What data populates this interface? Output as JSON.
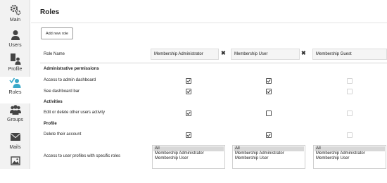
{
  "sidebar": {
    "items": [
      {
        "label": "Main",
        "icon": "gears-icon",
        "active": false
      },
      {
        "label": "Users",
        "icon": "user-icon",
        "active": false
      },
      {
        "label": "Profile",
        "icon": "profile-icon",
        "active": false
      },
      {
        "label": "Roles",
        "icon": "roles-icon",
        "active": true
      },
      {
        "label": "Groups",
        "icon": "groups-icon",
        "active": false
      },
      {
        "label": "Mails",
        "icon": "mail-icon",
        "active": false
      },
      {
        "label": "",
        "icon": "image-icon",
        "active": false
      }
    ]
  },
  "page": {
    "title": "Roles",
    "add_button_label": "Add new role"
  },
  "roles_table": {
    "name_header": "Role Name",
    "roles": [
      {
        "name": "Membership Administrator",
        "deletable": true
      },
      {
        "name": "Membership User",
        "deletable": true
      },
      {
        "name": "Membership Guest",
        "deletable": false
      }
    ],
    "delete_symbol": "✖",
    "sections": [
      {
        "title": "Administrative permissions",
        "rows": [
          {
            "label": "Access to admin dashboard",
            "values": [
              true,
              true,
              false
            ],
            "disabled": [
              false,
              false,
              true
            ]
          },
          {
            "label": "See dashboard bar",
            "values": [
              true,
              true,
              false
            ],
            "disabled": [
              false,
              false,
              true
            ]
          }
        ]
      },
      {
        "title": "Activities",
        "rows": [
          {
            "label": "Edit or delete other users activity",
            "values": [
              true,
              false,
              false
            ],
            "disabled": [
              false,
              false,
              true
            ]
          }
        ]
      },
      {
        "title": "Profile",
        "rows": [
          {
            "label": "Delete their account",
            "values": [
              true,
              true,
              false
            ],
            "disabled": [
              false,
              false,
              true
            ]
          }
        ]
      }
    ],
    "profiles_access": {
      "label": "Access to user profiles with specific roles",
      "options": [
        "All",
        "Membership Administrator",
        "Membership User"
      ],
      "selected": "All"
    }
  },
  "colors": {
    "sidebar_bg": "#f2f2f2",
    "active_icon": "#3aa9c9",
    "icon": "#444444",
    "input_bg": "#f5f5f5",
    "selected_option_bg": "#d8d8d8"
  }
}
